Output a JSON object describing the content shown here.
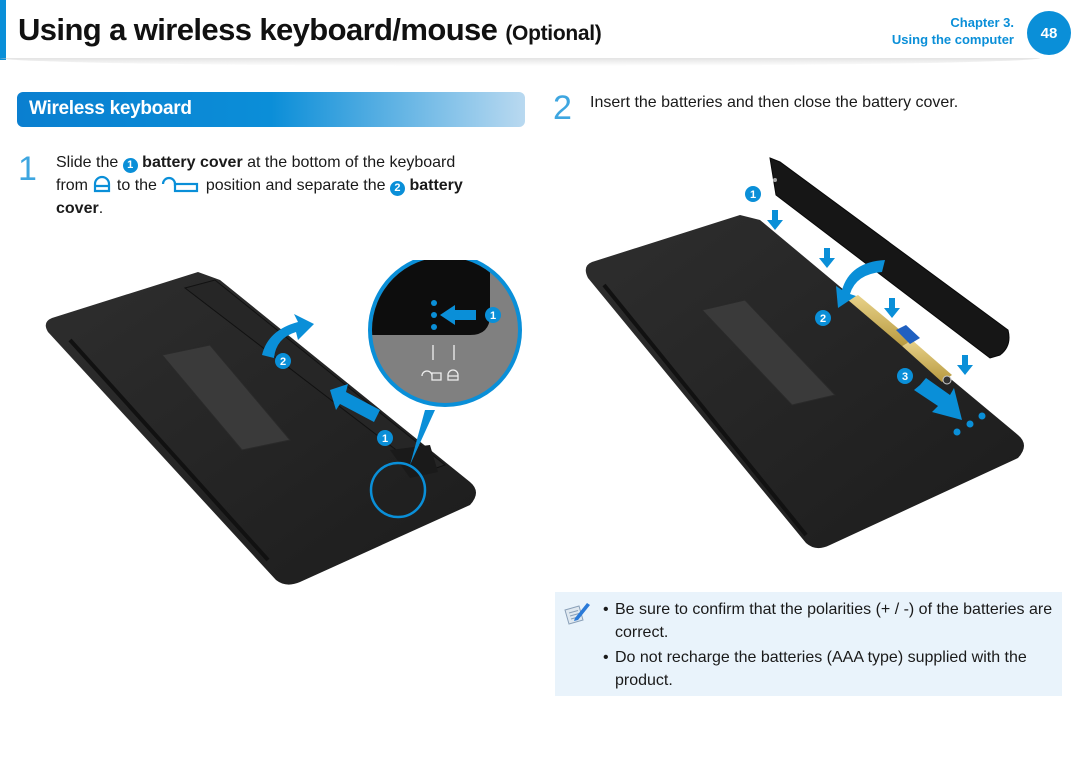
{
  "header": {
    "title": "Using a wireless keyboard/mouse",
    "title_suffix": "(Optional)",
    "chapter_line1": "Chapter 3.",
    "chapter_line2": "Using the computer",
    "page_number": "48",
    "accent_color": "#0a8fd8"
  },
  "section": {
    "title": "Wireless keyboard"
  },
  "steps": [
    {
      "number": "1",
      "parts": {
        "t1": "Slide the",
        "c1": "1",
        "b1": "battery cover",
        "t2": "at the bottom of the keyboard",
        "t3": "from",
        "icon1": "locked-icon",
        "t4": "to the",
        "icon2": "unlocked-icon",
        "t5": "position and separate the",
        "c2": "2",
        "b2": "battery",
        "b3": "cover",
        "t6": "."
      },
      "illustration": {
        "callouts": [
          "1",
          "2",
          "1"
        ],
        "zoom_symbols": [
          "unlocked-icon",
          "locked-icon"
        ]
      }
    },
    {
      "number": "2",
      "text": "Insert the batteries and then close the battery cover.",
      "illustration": {
        "callouts": [
          "1",
          "2",
          "3"
        ]
      }
    }
  ],
  "note": {
    "icon": "note-pencil-icon",
    "items": [
      {
        "bullet": "•",
        "text": "Be sure to confirm that the polarities (+ / -) of the batteries are correct."
      },
      {
        "bullet": "•",
        "text": "Do not recharge the batteries (AAA type) supplied with the product."
      }
    ]
  }
}
